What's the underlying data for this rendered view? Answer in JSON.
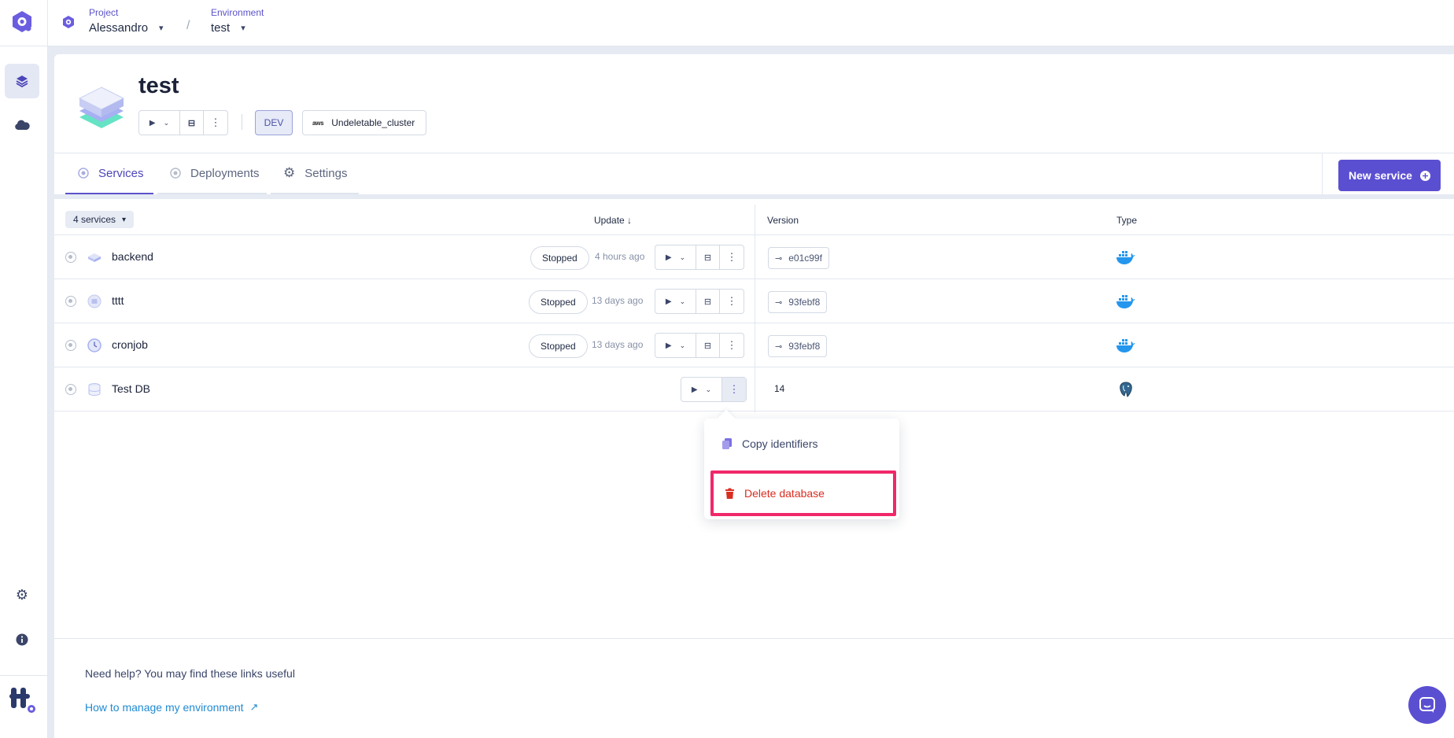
{
  "breadcrumb": {
    "project_label": "Project",
    "project_value": "Alessandro",
    "separator": "/",
    "environment_label": "Environment",
    "environment_value": "test"
  },
  "environment": {
    "title": "test",
    "mode_badge": "DEV",
    "cluster_name": "Undeletable_cluster",
    "cluster_provider": "aws"
  },
  "tabs": [
    {
      "label": "Services",
      "icon": "status-circle-icon",
      "active": true
    },
    {
      "label": "Deployments",
      "icon": "status-circle-icon",
      "active": false
    },
    {
      "label": "Settings",
      "icon": "gear-icon",
      "active": false
    }
  ],
  "new_service_label": "New service",
  "table": {
    "count_label": "4 services",
    "columns": {
      "update": "Update",
      "version": "Version",
      "type": "Type"
    },
    "rows": [
      {
        "name": "backend",
        "status": "Stopped",
        "updated": "4 hours ago",
        "version": "e01c99f",
        "type_icon": "docker-icon"
      },
      {
        "name": "tttt",
        "status": "Stopped",
        "updated": "13 days ago",
        "version": "93febf8",
        "type_icon": "docker-icon"
      },
      {
        "name": "cronjob",
        "status": "Stopped",
        "updated": "13 days ago",
        "version": "93febf8",
        "type_icon": "docker-icon"
      },
      {
        "name": "Test DB",
        "status": "",
        "updated": "",
        "version": "14",
        "type_icon": "postgresql-icon"
      }
    ]
  },
  "menu": {
    "copy_label": "Copy identifiers",
    "delete_label": "Delete database"
  },
  "footer": {
    "help_text": "Need help? You may find these links useful",
    "link_text": "How to manage my environment"
  },
  "colors": {
    "brand": "#5b4fd1",
    "danger": "#d92d20",
    "highlight": "#f0286a",
    "link": "#1f8ad2"
  }
}
